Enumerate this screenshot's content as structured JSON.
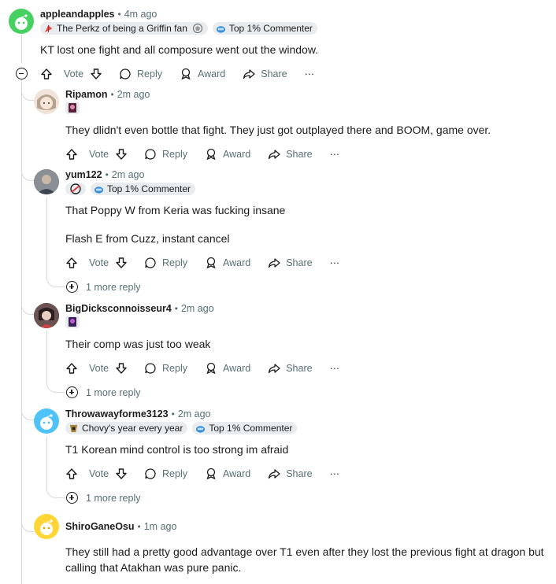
{
  "comments": [
    {
      "username": "appleandapples",
      "time": "4m ago",
      "flair_1": "The Perkz of being a Griffin fan",
      "flair_2": "Top 1% Commenter",
      "body": "KT lost one fight and all composure went out the window."
    },
    {
      "username": "Ripamon",
      "time": "2m ago",
      "body": "They dlidn't even bottle that fight. They just got outplayed there and BOOM, game over."
    },
    {
      "username": "yum122",
      "time": "2m ago",
      "flair_2": "Top 1% Commenter",
      "body_line1": "That Poppy W from Keria was fucking insane",
      "body_line2": "Flash E from Cuzz, instant cancel",
      "more_replies": "1 more reply"
    },
    {
      "username": "BigDicksconnoisseur4",
      "time": "2m ago",
      "body": "Their comp was just too weak",
      "more_replies": "1 more reply"
    },
    {
      "username": "Throwawayforme3123",
      "time": "2m ago",
      "flair_1": "Chovy's year every year",
      "flair_2": "Top 1% Commenter",
      "body": "T1 Korean mind control is too strong im afraid",
      "more_replies": "1 more reply"
    },
    {
      "username": "ShiroGaneOsu",
      "time": "1m ago",
      "body": "They still had a pretty good advantage over T1 even after they lost the previous fight at dragon but calling that Atakhan was pure panic."
    }
  ],
  "actions": {
    "vote": "Vote",
    "reply": "Reply",
    "award": "Award",
    "share": "Share",
    "more": "···"
  },
  "colors": {
    "meta": "#576f76",
    "thread_line": "#d5dadc",
    "flair_bg": "#e9ecef",
    "avatar_green": "#46d160",
    "avatar_teal": "#24a0ed",
    "avatar_yellow": "#ffd635"
  }
}
